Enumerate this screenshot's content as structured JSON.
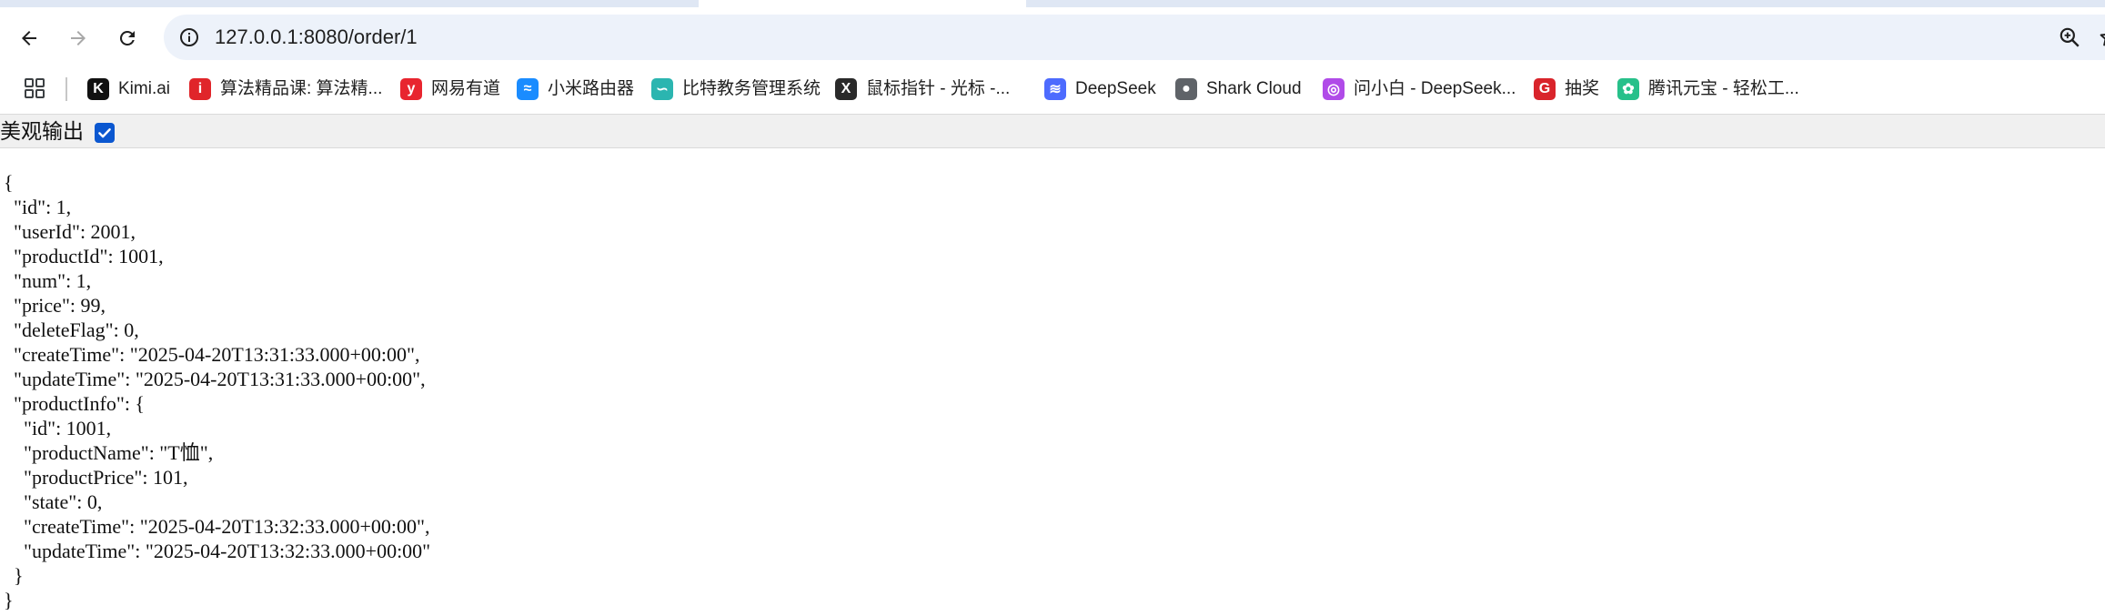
{
  "browser": {
    "url": "127.0.0.1:8080/order/1",
    "icons": {
      "back": "arrow-left-icon",
      "forward": "arrow-right-icon",
      "reload": "reload-icon",
      "site_info": "info-icon",
      "zoom": "zoom-icon",
      "bookmark": "star-icon",
      "apps": "apps-grid-icon"
    }
  },
  "bookmarks": [
    {
      "label": "Kimi.ai",
      "icon": "K",
      "color": "#111111"
    },
    {
      "label": "算法精品课: 算法精...",
      "icon": "i",
      "color": "#e0252a"
    },
    {
      "label": "网易有道",
      "icon": "y",
      "color": "#e8252f"
    },
    {
      "label": "小米路由器",
      "icon": "≈",
      "color": "#1a8cff"
    },
    {
      "label": "比特教务管理系统",
      "icon": "∽",
      "color": "#2bb5b0"
    },
    {
      "label": "鼠标指针 - 光标 -...",
      "icon": "X",
      "color": "#2a2a2a"
    },
    {
      "label": "DeepSeek",
      "icon": "≋",
      "color": "#4d6bfe"
    },
    {
      "label": "Shark Cloud",
      "icon": "●",
      "color": "#5f6368"
    },
    {
      "label": "问小白 - DeepSeek...",
      "icon": "◎",
      "color": "#b04be8"
    },
    {
      "label": "抽奖",
      "icon": "G",
      "color": "#d9242b"
    },
    {
      "label": "腾讯元宝 - 轻松工...",
      "icon": "✿",
      "color": "#27c08a"
    }
  ],
  "pretty_print": {
    "label": "美观输出",
    "checked": true
  },
  "json_text": "{\n  \"id\": 1,\n  \"userId\": 2001,\n  \"productId\": 1001,\n  \"num\": 1,\n  \"price\": 99,\n  \"deleteFlag\": 0,\n  \"createTime\": \"2025-04-20T13:31:33.000+00:00\",\n  \"updateTime\": \"2025-04-20T13:31:33.000+00:00\",\n  \"productInfo\": {\n    \"id\": 1001,\n    \"productName\": \"T恤\",\n    \"productPrice\": 101,\n    \"state\": 0,\n    \"createTime\": \"2025-04-20T13:32:33.000+00:00\",\n    \"updateTime\": \"2025-04-20T13:32:33.000+00:00\"\n  }\n}"
}
